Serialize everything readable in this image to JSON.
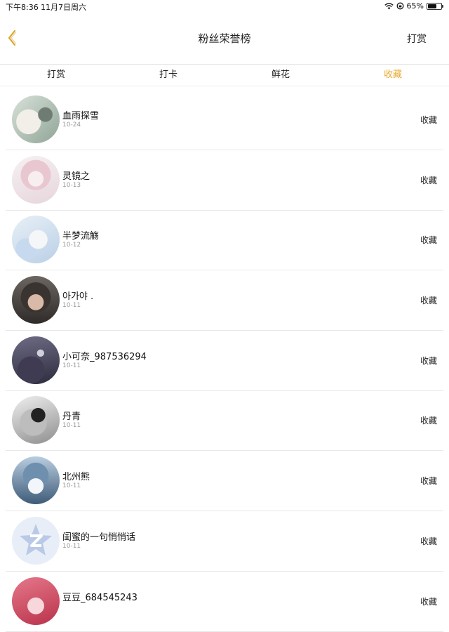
{
  "status_bar": {
    "time": "下午8:36",
    "date": "11月7日周六",
    "battery": "65%",
    "battery_level": 0.65
  },
  "nav": {
    "title": "粉丝荣誉榜",
    "right_button": "打赏",
    "accent_color": "#e8a830"
  },
  "tabs": [
    {
      "label": "打赏",
      "active": false
    },
    {
      "label": "打卡",
      "active": false
    },
    {
      "label": "鲜花",
      "active": false
    },
    {
      "label": "收藏",
      "active": true
    }
  ],
  "fans": [
    {
      "name": "血雨探雪",
      "date": "10-24",
      "action": "收藏"
    },
    {
      "name": "灵镜之",
      "date": "10-13",
      "action": "收藏"
    },
    {
      "name": "半梦流觞",
      "date": "10-12",
      "action": "收藏"
    },
    {
      "name": "아가야 .",
      "date": "10-11",
      "action": "收藏"
    },
    {
      "name": "小可奈_987536294",
      "date": "10-11",
      "action": "收藏"
    },
    {
      "name": "丹青",
      "date": "10-11",
      "action": "收藏"
    },
    {
      "name": "北州熊",
      "date": "10-11",
      "action": "收藏"
    },
    {
      "name": "闺蜜的一句悄悄话",
      "date": "10-11",
      "action": "收藏"
    },
    {
      "name": "豆豆_684545243",
      "date": "",
      "action": "收藏"
    }
  ]
}
